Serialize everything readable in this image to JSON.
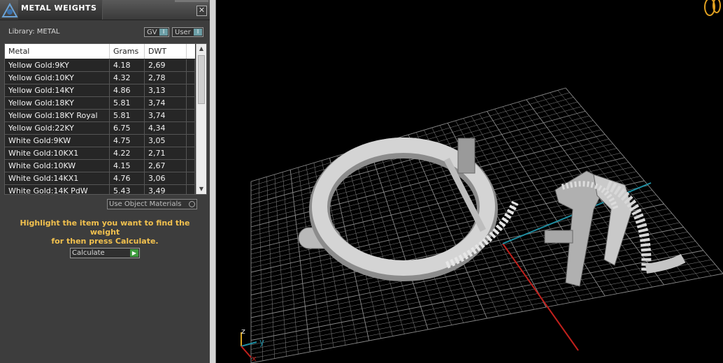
{
  "window": {
    "title": "METAL WEIGHTS",
    "close_glyph": "✕"
  },
  "library": {
    "label": "Library: METAL"
  },
  "toggles": {
    "gv_label": "GV",
    "user_label": "User",
    "knob_glyph": "I"
  },
  "table": {
    "headers": {
      "metal": "Metal",
      "grams": "Grams",
      "dwt": "DWT"
    },
    "rows": [
      {
        "metal": "Yellow Gold:9KY",
        "grams": "4.18",
        "dwt": "2,69"
      },
      {
        "metal": "Yellow Gold:10KY",
        "grams": "4.32",
        "dwt": "2,78"
      },
      {
        "metal": "Yellow Gold:14KY",
        "grams": "4.86",
        "dwt": "3,13"
      },
      {
        "metal": "Yellow Gold:18KY",
        "grams": "5.81",
        "dwt": "3,74"
      },
      {
        "metal": "Yellow Gold:18KY Royal",
        "grams": "5.81",
        "dwt": "3,74"
      },
      {
        "metal": "Yellow Gold:22KY",
        "grams": "6.75",
        "dwt": "4,34"
      },
      {
        "metal": "White Gold:9KW",
        "grams": "4.75",
        "dwt": "3,05"
      },
      {
        "metal": "White Gold:10KX1",
        "grams": "4.22",
        "dwt": "2,71"
      },
      {
        "metal": "White Gold:10KW",
        "grams": "4.15",
        "dwt": "2,67"
      },
      {
        "metal": "White Gold:14KX1",
        "grams": "4.76",
        "dwt": "3,06"
      },
      {
        "metal": "White Gold:14K PdW",
        "grams": "5.43",
        "dwt": "3,49"
      }
    ]
  },
  "use_object_materials": {
    "label": "Use Object Materials"
  },
  "hint": {
    "line1": "Highlight the item you want to find the weight",
    "line2": "for then press Calculate."
  },
  "calculate": {
    "label": "Calculate",
    "arrow_glyph": "▶"
  },
  "viewport": {
    "axis_labels": {
      "z": "z",
      "y": "y",
      "x": "x"
    },
    "colors": {
      "grid": "#8a8a8a",
      "x_axis": "#c0201c",
      "y_axis": "#1f8fa3",
      "model": "#c8c8c8",
      "hint": "#f2c14e"
    }
  }
}
